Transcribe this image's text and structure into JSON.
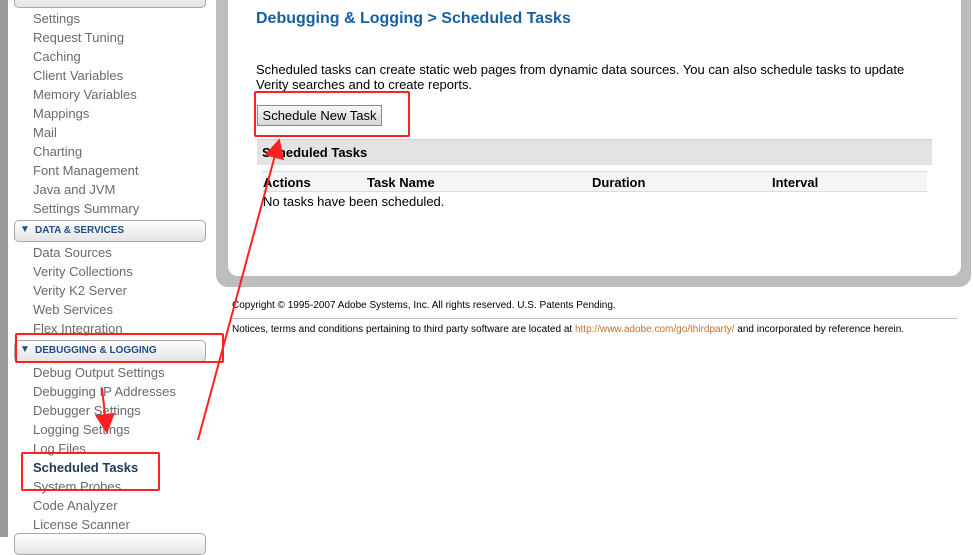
{
  "sidebar": {
    "server_settings_items": [
      "Settings",
      "Request Tuning",
      "Caching",
      "Client Variables",
      "Memory Variables",
      "Mappings",
      "Mail",
      "Charting",
      "Font Management",
      "Java and JVM",
      "Settings Summary"
    ],
    "data_services_label": "DATA & SERVICES",
    "data_services_items": [
      "Data Sources",
      "Verity Collections",
      "Verity K2 Server",
      "Web Services",
      "Flex Integration"
    ],
    "debugging_label": "DEBUGGING & LOGGING",
    "debugging_items": [
      "Debug Output Settings",
      "Debugging IP Addresses",
      "Debugger Settings",
      "Logging Settings",
      "Log Files",
      "Scheduled Tasks",
      "System Probes",
      "Code Analyzer",
      "License Scanner"
    ]
  },
  "main": {
    "title": "Debugging & Logging > Scheduled Tasks",
    "intro": "Scheduled tasks can create static web pages from dynamic data sources. You can also schedule tasks to update Verity searches and to create reports.",
    "schedule_button": "Schedule New Task",
    "table_title": "Scheduled Tasks",
    "columns": [
      "Actions",
      "Task Name",
      "Duration",
      "Interval"
    ],
    "empty_message": "No tasks have been scheduled."
  },
  "footer": {
    "copyright": "Copyright © 1995-2007 Adobe Systems, Inc. All rights reserved. U.S. Patents Pending.",
    "notice_prefix": "Notices, terms and conditions pertaining to third party software are located at",
    "notice_link": "http://www.adobe.com/go/thirdparty/",
    "notice_suffix": "and incorporated by reference herein."
  },
  "colors": {
    "annotation": "#ff2020",
    "title": "#1a5fa0",
    "section_header": "#1a4f8a",
    "link": "#c8702a"
  }
}
